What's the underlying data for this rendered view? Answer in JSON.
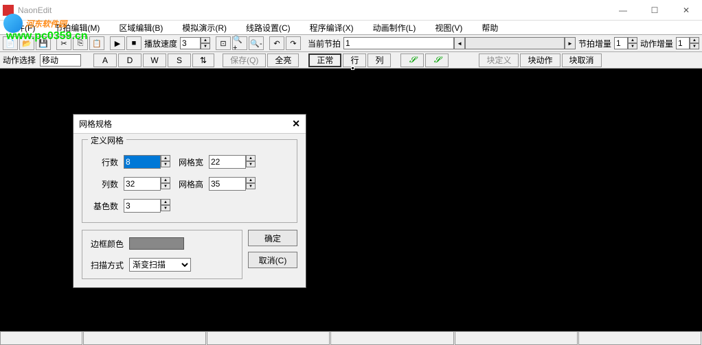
{
  "title": "NaonEdit",
  "watermark": {
    "text": "河东软件园",
    "url": "www.pc0359.cn"
  },
  "menu": {
    "file": "文件(F)",
    "beat_edit": "节拍编辑(M)",
    "area_edit": "区域编辑(B)",
    "simulate": "模拟演示(R)",
    "line_setup": "线路设置(C)",
    "compile": "程序编译(X)",
    "anim": "动画制作(L)",
    "view": "视图(V)",
    "help": "帮助"
  },
  "toolbar": {
    "play_speed_label": "播放速度",
    "play_speed": "3",
    "current_beat_label": "当前节拍",
    "current_beat": "1",
    "beat_inc_label": "节拍增量",
    "beat_inc": "1",
    "action_inc_label": "动作增量",
    "action_inc": "1"
  },
  "toolbar2": {
    "action_select_label": "动作选择",
    "action_select": "移动",
    "btn_A": "A",
    "btn_D": "D",
    "btn_W": "W",
    "btn_S": "S",
    "save": "保存(Q)",
    "all_bright": "全亮",
    "normal": "正常",
    "row": "行",
    "col": "列",
    "block_define": "块定义",
    "block_action": "块动作",
    "block_cancel": "块取消"
  },
  "dialog": {
    "title": "网格规格",
    "group_label": "定义网格",
    "rows_label": "行数",
    "rows": "8",
    "cols_label": "列数",
    "cols": "32",
    "grid_w_label": "网格宽",
    "grid_w": "22",
    "grid_h_label": "网格高",
    "grid_h": "35",
    "base_colors_label": "基色数",
    "base_colors": "3",
    "border_color_label": "边框颜色",
    "scan_mode_label": "扫描方式",
    "scan_mode": "渐变扫描",
    "ok": "确定",
    "cancel": "取消(C)"
  }
}
